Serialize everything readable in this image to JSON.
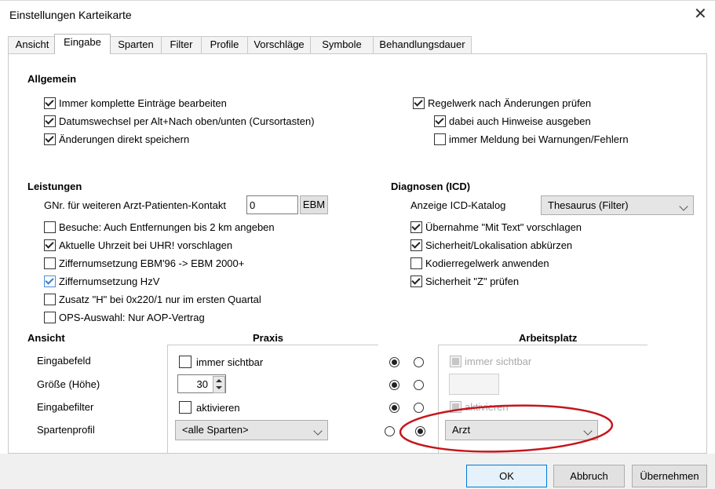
{
  "window": {
    "title": "Einstellungen Karteikarte",
    "close_label": "✕"
  },
  "tabs": [
    "Ansicht",
    "Eingabe",
    "Sparten",
    "Filter",
    "Profile",
    "Vorschläge",
    "Symbole",
    "Behandlungsdauer"
  ],
  "allgemein": {
    "heading": "Allgemein",
    "left": [
      {
        "label": "Immer komplette Einträge bearbeiten",
        "checked": true
      },
      {
        "label": "Datumswechsel per Alt+Nach oben/unten (Cursortasten)",
        "checked": true
      },
      {
        "label": "Änderungen direkt speichern",
        "checked": true
      }
    ],
    "right": [
      {
        "label": "Regelwerk nach Änderungen prüfen",
        "checked": true
      },
      {
        "label": "dabei auch Hinweise ausgeben",
        "checked": true
      },
      {
        "label": "immer Meldung bei Warnungen/Fehlern",
        "checked": false
      }
    ]
  },
  "leistungen": {
    "heading": "Leistungen",
    "gnr_label": "GNr. für weiteren Arzt-Patienten-Kontakt",
    "gnr_value": "0",
    "ebm_button": "EBM",
    "options": [
      {
        "label": "Besuche: Auch Entfernungen bis 2 km angeben",
        "checked": false
      },
      {
        "label": "Aktuelle Uhrzeit bei UHR! vorschlagen",
        "checked": true
      },
      {
        "label": "Ziffernumsetzung EBM'96 -> EBM 2000+",
        "checked": false
      },
      {
        "label": "Ziffernumsetzung HzV",
        "checked": true
      },
      {
        "label": "Zusatz \"H\" bei 0x220/1 nur im ersten Quartal",
        "checked": false
      },
      {
        "label": "OPS-Auswahl: Nur AOP-Vertrag",
        "checked": false
      }
    ]
  },
  "diagnosen": {
    "heading": "Diagnosen (ICD)",
    "katalog_label": "Anzeige ICD-Katalog",
    "katalog_value": "Thesaurus (Filter)",
    "options": [
      {
        "label": "Übernahme \"Mit Text\" vorschlagen",
        "checked": true
      },
      {
        "label": "Sicherheit/Lokalisation abkürzen",
        "checked": true
      },
      {
        "label": "Kodierregelwerk anwenden",
        "checked": false
      },
      {
        "label": "Sicherheit \"Z\" prüfen",
        "checked": true
      }
    ]
  },
  "ansicht": {
    "heading": "Ansicht",
    "praxis_heading": "Praxis",
    "arbeitsplatz_heading": "Arbeitsplatz",
    "rows": {
      "eingabefeld": {
        "label": "Eingabefeld",
        "praxis": "immer sichtbar",
        "arbeitsplatz": "immer sichtbar"
      },
      "groesse": {
        "label": "Größe (Höhe)",
        "praxis": "30"
      },
      "eingabefilter": {
        "label": "Eingabefilter",
        "praxis": "aktivieren",
        "arbeitsplatz": "aktivieren"
      },
      "spartenprofil": {
        "label": "Spartenprofil",
        "praxis": "<alle Sparten>",
        "arbeitsplatz": "Arzt"
      }
    }
  },
  "footer": {
    "ok": "OK",
    "abbruch": "Abbruch",
    "uebernehmen": "Übernehmen"
  },
  "colors": {
    "annotation_ellipse": "#c4161c",
    "default_button_border": "#0078d7"
  }
}
